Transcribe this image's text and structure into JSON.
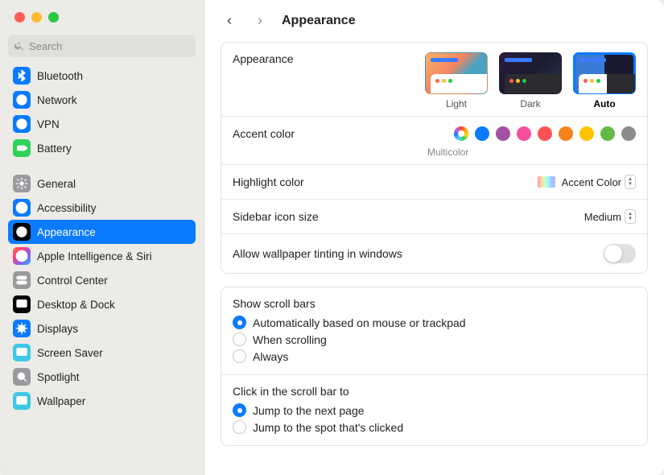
{
  "search": {
    "placeholder": "Search"
  },
  "header": {
    "title": "Appearance"
  },
  "sidebar": {
    "groups": [
      {
        "items": [
          {
            "label": "Bluetooth",
            "icon": "bluetooth-icon",
            "color": "#0a7bff"
          },
          {
            "label": "Network",
            "icon": "globe-icon",
            "color": "#0a7bff"
          },
          {
            "label": "VPN",
            "icon": "vpn-icon",
            "color": "#0a7bff"
          },
          {
            "label": "Battery",
            "icon": "battery-icon",
            "color": "#30d158"
          }
        ]
      },
      {
        "items": [
          {
            "label": "General",
            "icon": "gear-icon",
            "color": "#9a9a9e"
          },
          {
            "label": "Accessibility",
            "icon": "accessibility-icon",
            "color": "#0a7bff"
          },
          {
            "label": "Appearance",
            "icon": "appearance-icon",
            "color": "#000000",
            "selected": true
          },
          {
            "label": "Apple Intelligence & Siri",
            "icon": "siri-icon",
            "color": "grad-siri"
          },
          {
            "label": "Control Center",
            "icon": "switches-icon",
            "color": "#9a9a9e"
          },
          {
            "label": "Desktop & Dock",
            "icon": "dock-icon",
            "color": "#000000"
          },
          {
            "label": "Displays",
            "icon": "displays-icon",
            "color": "#0a7bff"
          },
          {
            "label": "Screen Saver",
            "icon": "screensaver-icon",
            "color": "#3fc8e6"
          },
          {
            "label": "Spotlight",
            "icon": "spotlight-icon",
            "color": "#9a9a9e"
          },
          {
            "label": "Wallpaper",
            "icon": "wallpaper-icon",
            "color": "#3fc8e6"
          }
        ]
      }
    ]
  },
  "appearance": {
    "section_label": "Appearance",
    "modes": [
      {
        "key": "light",
        "label": "Light"
      },
      {
        "key": "dark",
        "label": "Dark"
      },
      {
        "key": "auto",
        "label": "Auto",
        "selected": true
      }
    ]
  },
  "accent": {
    "label": "Accent color",
    "selected_name": "Multicolor",
    "swatches": [
      {
        "name": "multicolor",
        "color": "multi",
        "selected": true
      },
      {
        "name": "blue",
        "color": "#0a7bff"
      },
      {
        "name": "purple",
        "color": "#a550a7"
      },
      {
        "name": "pink",
        "color": "#f74f9e"
      },
      {
        "name": "red",
        "color": "#ff5257"
      },
      {
        "name": "orange",
        "color": "#f7821b"
      },
      {
        "name": "yellow",
        "color": "#ffc600"
      },
      {
        "name": "green",
        "color": "#62ba46"
      },
      {
        "name": "graphite",
        "color": "#8c8c8c"
      }
    ]
  },
  "highlight": {
    "label": "Highlight color",
    "value": "Accent Color"
  },
  "sidebar_icon": {
    "label": "Sidebar icon size",
    "value": "Medium"
  },
  "tinting": {
    "label": "Allow wallpaper tinting in windows",
    "on": false
  },
  "scrollbars": {
    "title": "Show scroll bars",
    "options": [
      {
        "label": "Automatically based on mouse or trackpad",
        "checked": true
      },
      {
        "label": "When scrolling"
      },
      {
        "label": "Always"
      }
    ]
  },
  "scrollclick": {
    "title": "Click in the scroll bar to",
    "options": [
      {
        "label": "Jump to the next page",
        "checked": true
      },
      {
        "label": "Jump to the spot that's clicked"
      }
    ]
  }
}
